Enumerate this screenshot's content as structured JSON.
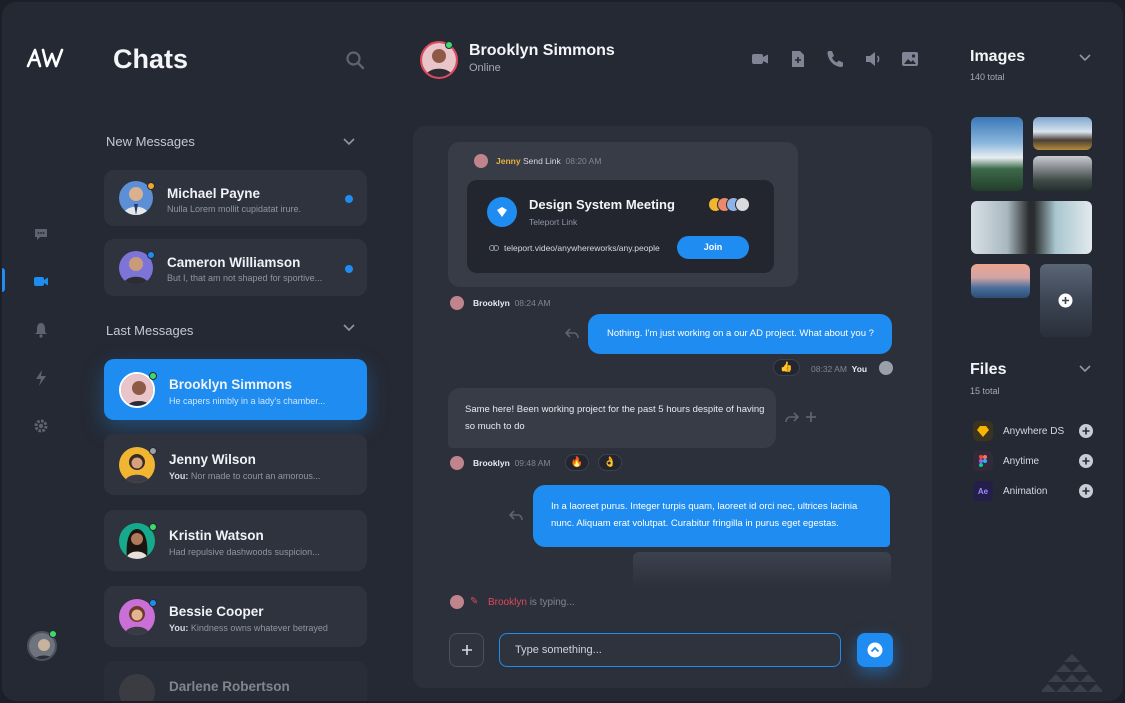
{
  "sidebar": {
    "logo_text": "AW",
    "nav": [
      "chat-icon",
      "video-icon",
      "bell-icon",
      "bolt-icon",
      "gear-icon"
    ]
  },
  "chat_list": {
    "title": "Chats",
    "new_messages_label": "New Messages",
    "last_messages_label": "Last Messages",
    "new_messages": [
      {
        "name": "Michael Payne",
        "preview": "Nulla Lorem mollit cupidatat irure."
      },
      {
        "name": "Cameron Williamson",
        "preview": "But I, that am not shaped for sportive..."
      }
    ],
    "last_messages": [
      {
        "name": "Brooklyn Simmons",
        "preview": "He capers nimbly in a lady's chamber..."
      },
      {
        "name": "Jenny Wilson",
        "you": "You:",
        "preview": "Nor made to court an amorous..."
      },
      {
        "name": "Kristin Watson",
        "preview": "Had repulsive dashwoods suspicion..."
      },
      {
        "name": "Bessie Cooper",
        "you": "You:",
        "preview": "Kindness owns whatever betrayed"
      },
      {
        "name": "Darlene Robertson"
      }
    ]
  },
  "conversation": {
    "contact_name": "Brooklyn Simmons",
    "contact_status": "Online",
    "header_icons": [
      "video-call-icon",
      "document-icon",
      "phone-icon",
      "speaker-icon",
      "gallery-icon"
    ],
    "link_share": {
      "sender": "Jenny",
      "action": "Send Link",
      "time": "08:20 AM",
      "title": "Design System Meeting",
      "subtitle": "Teleport Link",
      "url": "teleport.video/anywhereworks/any.people",
      "join_label": "Join"
    },
    "msg1": {
      "author": "Brooklyn",
      "time": "08:24 AM"
    },
    "msg_out1": {
      "text": "Nothing. I'm just working on a our AD project. What about you ?",
      "time": "08:32 AM",
      "author": "You",
      "reaction": "👍"
    },
    "msg_in2": {
      "text": "Same here! Been working project for the past 5 hours despite of having so much to do",
      "author": "Brooklyn",
      "time": "09:48 AM",
      "reactions": [
        "🔥",
        "👌"
      ]
    },
    "msg_out2": {
      "text": "In a laoreet purus. Integer turpis quam, laoreet id orci nec, ultrices lacinia nunc. Aliquam erat volutpat. Curabitur fringilla in purus eget egestas."
    },
    "typing_name": "Brooklyn",
    "typing_text": "is typing...",
    "input_placeholder": "Type something..."
  },
  "images": {
    "title": "Images",
    "count": "140 total"
  },
  "files": {
    "title": "Files",
    "count": "15 total",
    "items": [
      {
        "name": "Anywhere DS",
        "icon": "sketch-icon"
      },
      {
        "name": "Anytime",
        "icon": "figma-icon"
      },
      {
        "name": "Animation",
        "icon": "ae-icon",
        "badge": "Ae"
      }
    ]
  },
  "colors": {
    "accent": "#1e8cf0",
    "background": "#252933",
    "card": "#2f333e",
    "online": "#3ddc6a"
  }
}
